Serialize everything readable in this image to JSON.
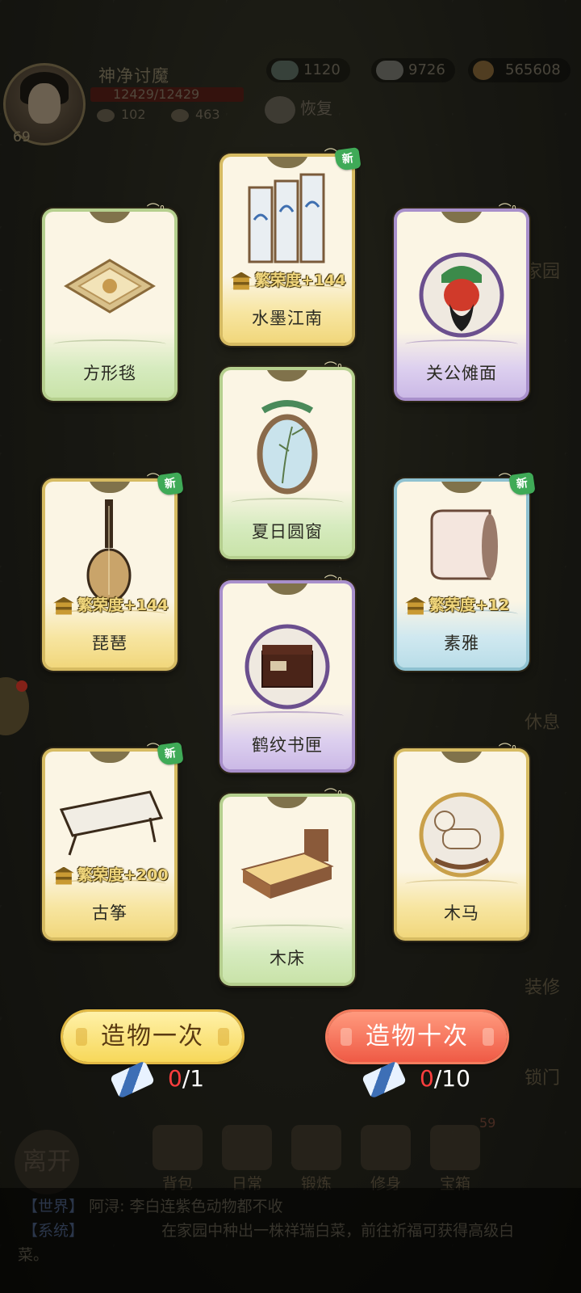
{
  "hud": {
    "player_name": "神净讨魔",
    "hp": "12429/12429",
    "level": "69",
    "stat1": "102",
    "stat2": "463",
    "res_jade": "1120",
    "res_silver": "9726",
    "res_coin": "565608",
    "recover_label": "恢复"
  },
  "cards": [
    {
      "name": "方形毯",
      "rarity": "green",
      "new": false,
      "prosperity": ""
    },
    {
      "name": "水墨江南",
      "rarity": "yellow",
      "new": true,
      "prosperity": "繁荣度+144"
    },
    {
      "name": "关公傩面",
      "rarity": "purple",
      "new": false,
      "prosperity": ""
    },
    {
      "name": "夏日圆窗",
      "rarity": "green",
      "new": false,
      "prosperity": ""
    },
    {
      "name": "琵琶",
      "rarity": "yellow",
      "new": true,
      "prosperity": "繁荣度+144"
    },
    {
      "name": "素雅",
      "rarity": "blue",
      "new": true,
      "prosperity": "繁荣度+12"
    },
    {
      "name": "鹤纹书匣",
      "rarity": "purple",
      "new": false,
      "prosperity": ""
    },
    {
      "name": "古筝",
      "rarity": "yellow",
      "new": true,
      "prosperity": "繁荣度+200"
    },
    {
      "name": "木马",
      "rarity": "yellow",
      "new": false,
      "prosperity": ""
    },
    {
      "name": "木床",
      "rarity": "green",
      "new": false,
      "prosperity": ""
    }
  ],
  "new_badge": "新",
  "actions": {
    "once_label": "造物一次",
    "ten_label": "造物十次",
    "once_have": "0",
    "once_need": "/1",
    "ten_have": "0",
    "ten_need": "/10"
  },
  "side": {
    "home": "家园",
    "rest": "休息",
    "decorate": "装修",
    "lock": "锁门"
  },
  "dock": {
    "leave": "离开",
    "bag": "背包",
    "daily": "日常",
    "forge": "锻炼",
    "cultivate": "修身",
    "treasure": "宝箱",
    "treasure_badge": "59"
  },
  "chat": {
    "row1_tag": "【世界】",
    "row1_text": "阿浔: 李白连紫色动物都不收",
    "row2_tag": "【系统】",
    "row2_text": "在家园中种出一株祥瑞白菜，前往祈福可获得高级白",
    "row3_text": "菜。"
  },
  "colors": {
    "green": "#b5cf8e",
    "yellow": "#d6bb62",
    "purple": "#a88fcb",
    "blue": "#8ec1d0",
    "once_button": "#f7d85a",
    "ten_button": "#ef5a45",
    "cost_deficit": "#ff3e3e"
  }
}
